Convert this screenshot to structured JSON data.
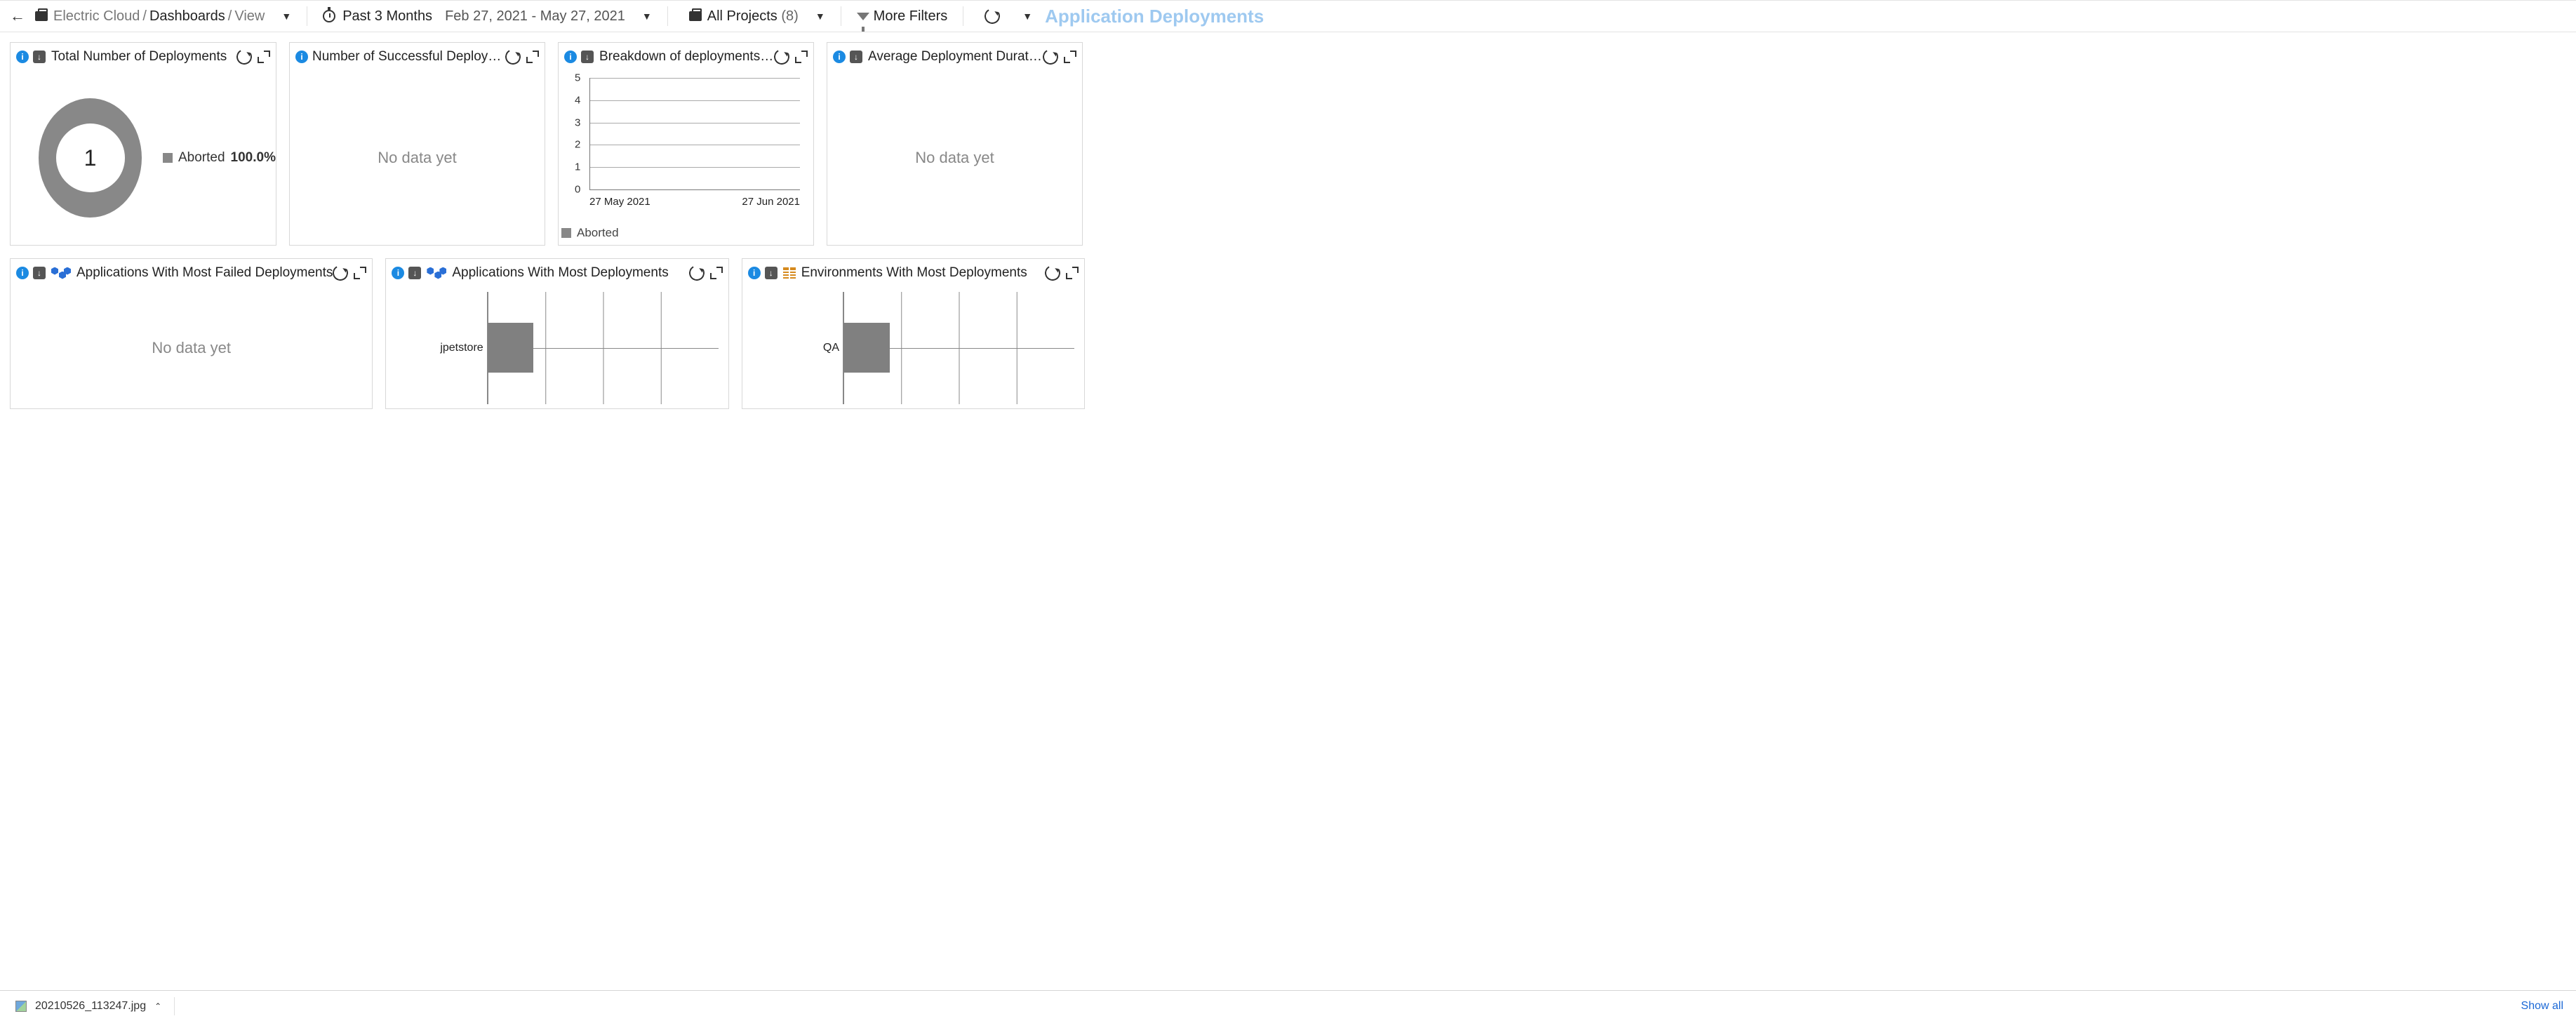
{
  "breadcrumb": {
    "org": "Electric Cloud",
    "section": "Dashboards",
    "page": "View"
  },
  "filters": {
    "date_preset": "Past 3 Months",
    "date_range": "Feb 27, 2021 - May 27, 2021",
    "projects_label": "All Projects",
    "projects_count": "(8)",
    "more_filters": "More Filters"
  },
  "page_title": "Application Deployments",
  "strings": {
    "no_data": "No data yet"
  },
  "widgets": {
    "total_deploys": {
      "title": "Total Number of Deployments",
      "center_value": "1",
      "legend_label": "Aborted",
      "legend_pct": "100.0%"
    },
    "successful": {
      "title": "Number of Successful Deployments"
    },
    "breakdown": {
      "title": "Breakdown of deployments by o...",
      "x_start": "27 May 2021",
      "x_end": "27 Jun 2021",
      "legend": "Aborted"
    },
    "avg_duration": {
      "title": "Average Deployment Duration"
    },
    "apps_failed": {
      "title": "Applications With Most Failed Deployments"
    },
    "apps_most": {
      "title": "Applications With Most Deployments",
      "row_label": "jpetstore"
    },
    "envs_most": {
      "title": "Environments With Most Deployments",
      "row_label": "QA"
    }
  },
  "tray": {
    "filename": "20210526_113247.jpg",
    "show_all": "Show all"
  },
  "chart_data": [
    {
      "type": "pie",
      "title": "Total Number of Deployments",
      "series": [
        {
          "name": "Aborted",
          "values": [
            1
          ]
        }
      ],
      "categories": [
        "Aborted"
      ],
      "total": 1
    },
    {
      "type": "line",
      "title": "Breakdown of deployments by outcome",
      "x": [
        "27 May 2021",
        "27 Jun 2021"
      ],
      "series": [
        {
          "name": "Aborted",
          "values": [
            0,
            0
          ]
        }
      ],
      "ylim": [
        0,
        5
      ],
      "yticks": [
        0,
        1,
        2,
        3,
        4,
        5
      ]
    },
    {
      "type": "bar",
      "orientation": "horizontal",
      "title": "Applications With Most Deployments",
      "categories": [
        "jpetstore"
      ],
      "values": [
        1
      ],
      "xlim": [
        0,
        5
      ]
    },
    {
      "type": "bar",
      "orientation": "horizontal",
      "title": "Environments With Most Deployments",
      "categories": [
        "QA"
      ],
      "values": [
        1
      ],
      "xlim": [
        0,
        5
      ]
    }
  ]
}
